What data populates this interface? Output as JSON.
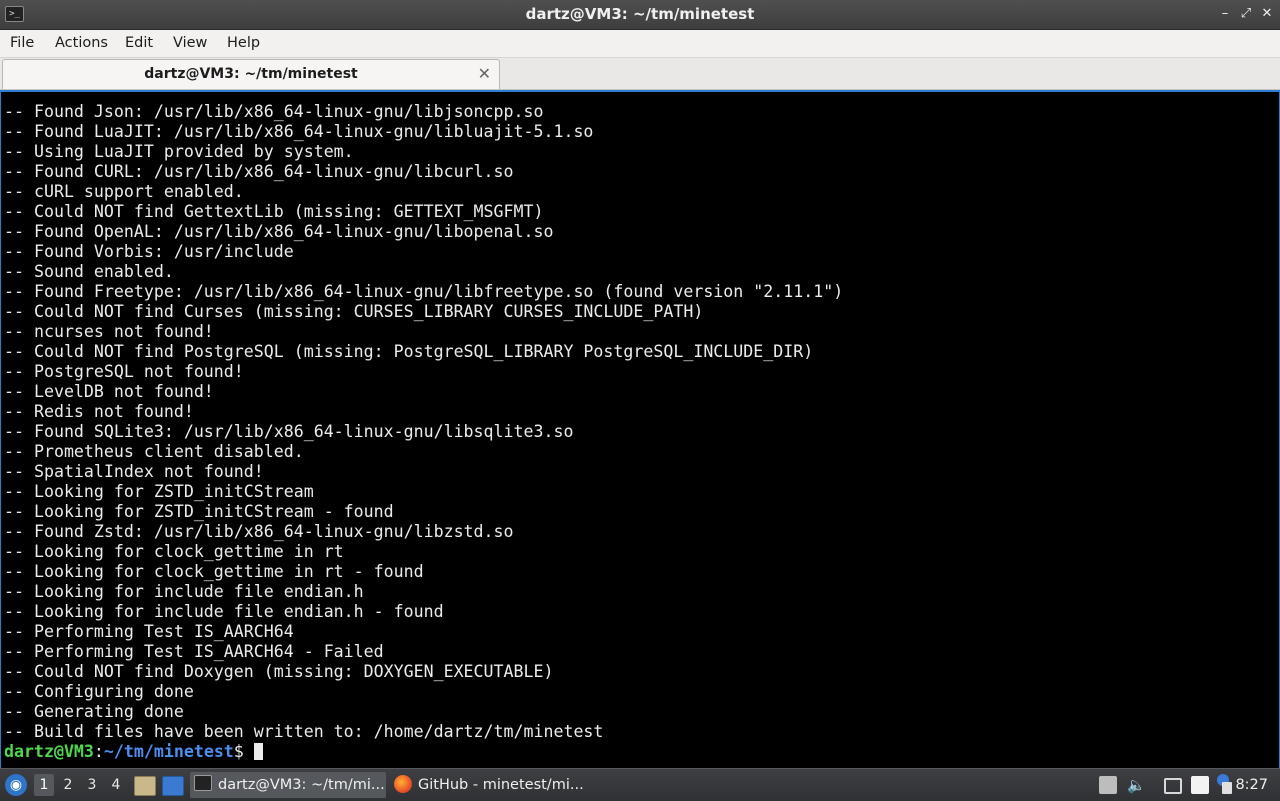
{
  "window": {
    "title": "dartz@VM3: ~/tm/minetest",
    "app_icon_glyph": ">_",
    "minimize_glyph": "–",
    "maximize_glyph": "⤢",
    "close_glyph": "✕"
  },
  "menu": [
    "File",
    "Actions",
    "Edit",
    "View",
    "Help"
  ],
  "tab": {
    "label": "dartz@VM3: ~/tm/minetest",
    "close_glyph": "✕"
  },
  "terminal": {
    "lines": [
      "-- Found Json: /usr/lib/x86_64-linux-gnu/libjsoncpp.so",
      "-- Found LuaJIT: /usr/lib/x86_64-linux-gnu/libluajit-5.1.so",
      "-- Using LuaJIT provided by system.",
      "-- Found CURL: /usr/lib/x86_64-linux-gnu/libcurl.so",
      "-- cURL support enabled.",
      "-- Could NOT find GettextLib (missing: GETTEXT_MSGFMT)",
      "-- Found OpenAL: /usr/lib/x86_64-linux-gnu/libopenal.so",
      "-- Found Vorbis: /usr/include",
      "-- Sound enabled.",
      "-- Found Freetype: /usr/lib/x86_64-linux-gnu/libfreetype.so (found version \"2.11.1\")",
      "-- Could NOT find Curses (missing: CURSES_LIBRARY CURSES_INCLUDE_PATH)",
      "-- ncurses not found!",
      "-- Could NOT find PostgreSQL (missing: PostgreSQL_LIBRARY PostgreSQL_INCLUDE_DIR)",
      "-- PostgreSQL not found!",
      "-- LevelDB not found!",
      "-- Redis not found!",
      "-- Found SQLite3: /usr/lib/x86_64-linux-gnu/libsqlite3.so",
      "-- Prometheus client disabled.",
      "-- SpatialIndex not found!",
      "-- Looking for ZSTD_initCStream",
      "-- Looking for ZSTD_initCStream - found",
      "-- Found Zstd: /usr/lib/x86_64-linux-gnu/libzstd.so",
      "-- Looking for clock_gettime in rt",
      "-- Looking for clock_gettime in rt - found",
      "-- Looking for include file endian.h",
      "-- Looking for include file endian.h - found",
      "-- Performing Test IS_AARCH64",
      "-- Performing Test IS_AARCH64 - Failed",
      "-- Could NOT find Doxygen (missing: DOXYGEN_EXECUTABLE)",
      "-- Configuring done",
      "-- Generating done",
      "-- Build files have been written to: /home/dartz/tm/minetest"
    ],
    "prompt": {
      "user_host": "dartz@VM3",
      "sep": ":",
      "path": "~/tm/minetest",
      "symbol": "$"
    }
  },
  "taskbar": {
    "start_icon": "start-menu-icon",
    "workspaces": [
      "1",
      "2",
      "3",
      "4"
    ],
    "active_workspace": "1",
    "tasks": [
      {
        "label": "dartz@VM3: ~/tm/mi...",
        "icon": "terminal-icon"
      },
      {
        "label": "GitHub - minetest/mi...",
        "icon": "firefox-icon"
      }
    ],
    "clock": "8:27"
  },
  "colors": {
    "terminal_bg": "#000000",
    "terminal_fg": "#ececec",
    "prompt_user": "#4ed74e",
    "prompt_path": "#4a8ff0",
    "focus_border": "#2a7fd4"
  }
}
